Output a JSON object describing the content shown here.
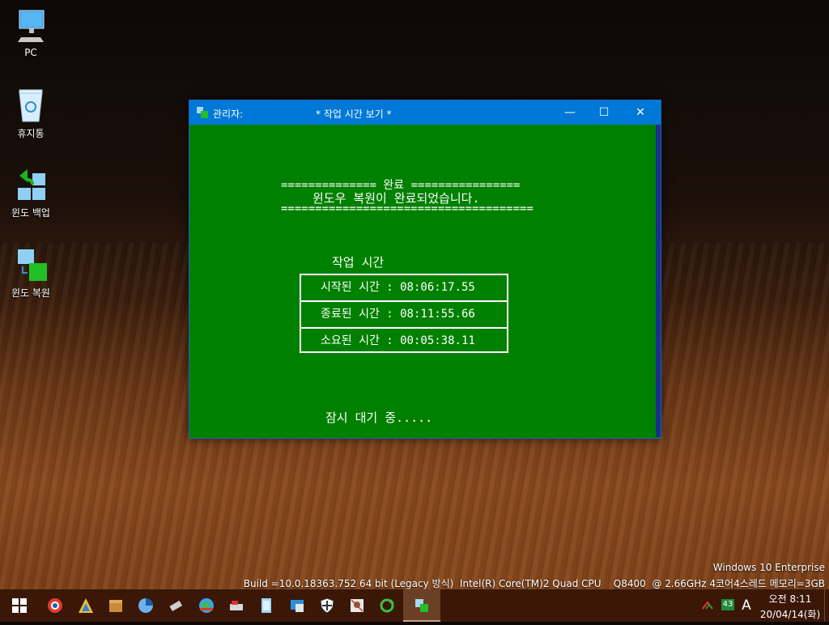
{
  "desktop": {
    "icons": [
      {
        "label": "PC",
        "icon": "monitor-icon"
      },
      {
        "label": "휴지통",
        "icon": "recycle-bin-icon"
      },
      {
        "label": "윈도 백업",
        "icon": "backup-icon"
      },
      {
        "label": "윈도 복원",
        "icon": "restore-icon"
      }
    ]
  },
  "window": {
    "title_prefix": "관리자:",
    "title": "* 작업 시간 보기 *",
    "controls": {
      "minimize": "—",
      "maximize": "☐",
      "close": "✕"
    }
  },
  "console": {
    "line1": "============== 완료 ================",
    "line2": "윈도우 복원이 완료되었습니다.",
    "line3": "=====================================",
    "section_title": "작업 시간",
    "rows": [
      "시작된 시간 : 08:06:17.55",
      "종료된 시간 : 08:11:55.66",
      "소요된 시간 : 00:05:38.11"
    ],
    "status": "잠시 대기 중....."
  },
  "sysinfo": {
    "edition": "Windows 10 Enterprise",
    "build": "Build =10.0.18363.752 64 bit (Legacy 방식)  Intel(R) Core(TM)2 Quad CPU    Q8400  @ 2.66GHz 4코어4스레드 메모리=3GB"
  },
  "taskbar": {
    "apps": [
      "browser-icon",
      "triangle-app-icon",
      "box-app-icon",
      "disk-app-icon",
      "tool-app-icon",
      "globe-app-icon",
      "drive-app-icon",
      "window-app-icon",
      "installer-app-icon",
      "shield-app-icon",
      "picture-app-icon",
      "refresh-app-icon",
      "console-app-icon"
    ],
    "tray": {
      "badge": "43",
      "ime": "A",
      "time": "오전 8:11",
      "date": "20/04/14(화)"
    }
  },
  "colors": {
    "console_bg": "#008000",
    "titlebar": "#0078d7",
    "taskbar": "#3a1707"
  }
}
